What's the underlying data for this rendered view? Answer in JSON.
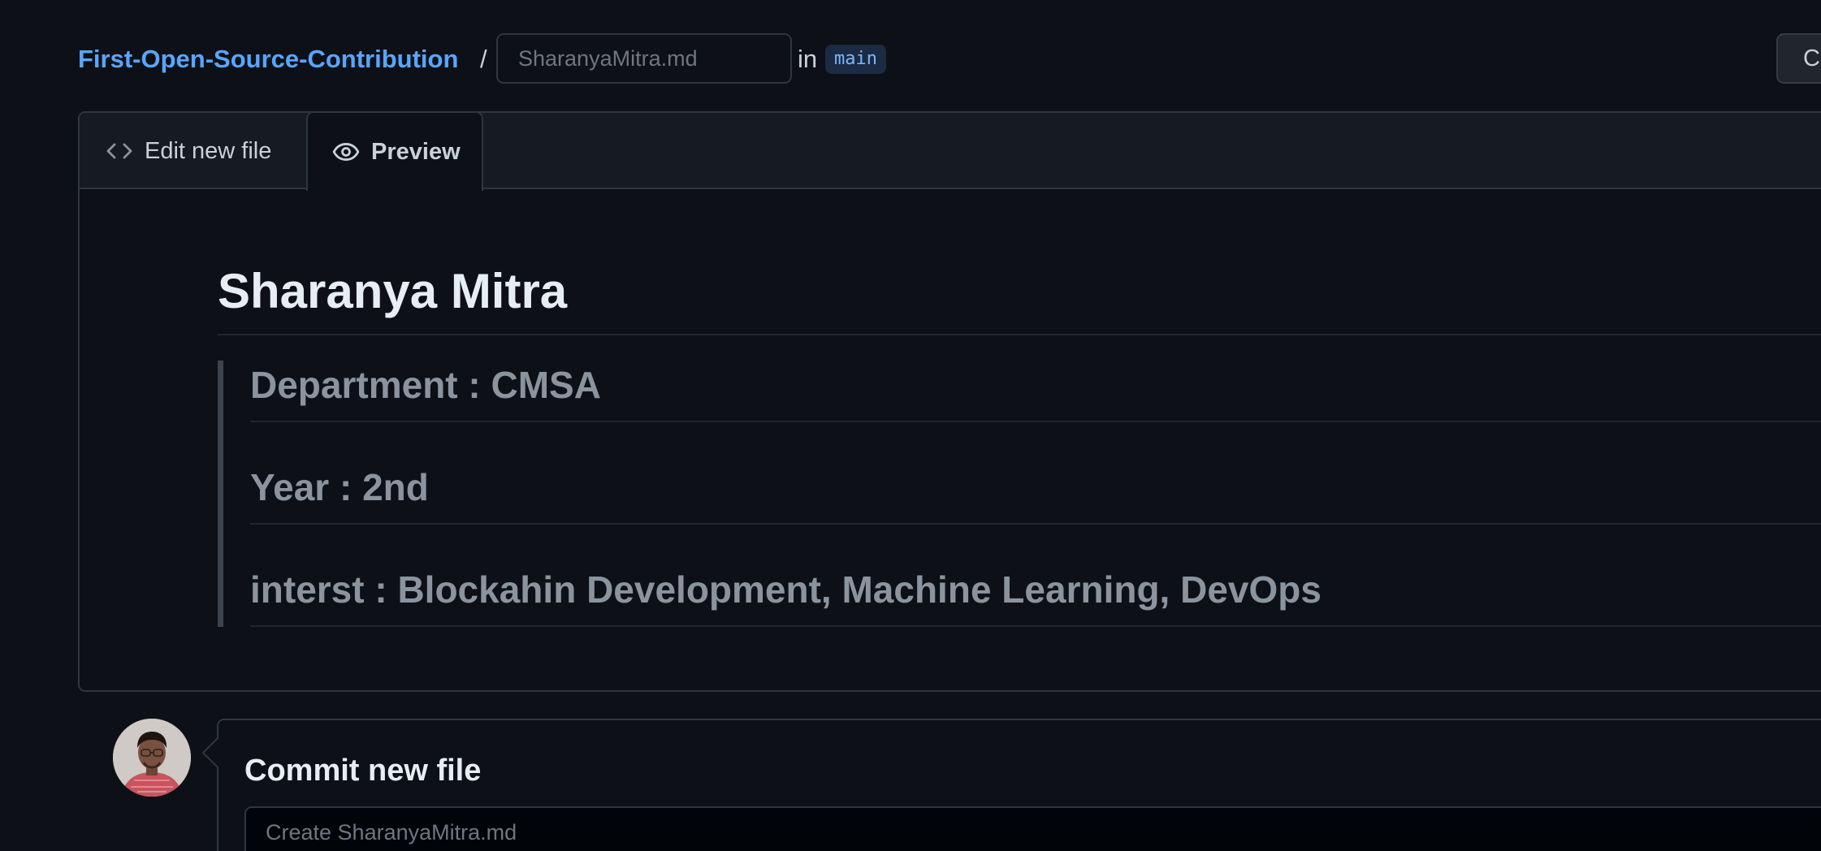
{
  "header": {
    "repo_name": "First-Open-Source-Contribution",
    "separator": "/",
    "filename_placeholder": "SharanyaMitra.md",
    "in_label": "in",
    "branch": "main",
    "cancel_label": "Ca"
  },
  "tabs": [
    {
      "label": "Edit new file",
      "icon": "code-icon",
      "active": false
    },
    {
      "label": "Preview",
      "icon": "eye-icon",
      "active": true
    }
  ],
  "preview": {
    "heading": "Sharanya Mitra",
    "quote_lines": [
      "Department : CMSA",
      "Year : 2nd",
      "interst : Blockahin Development, Machine Learning, DevOps"
    ]
  },
  "commit": {
    "title": "Commit new file",
    "message_placeholder": "Create SharanyaMitra.md"
  },
  "colors": {
    "background": "#0d1117",
    "link": "#58a6ff",
    "border": "#30363d",
    "muted_text": "#8b949e"
  }
}
